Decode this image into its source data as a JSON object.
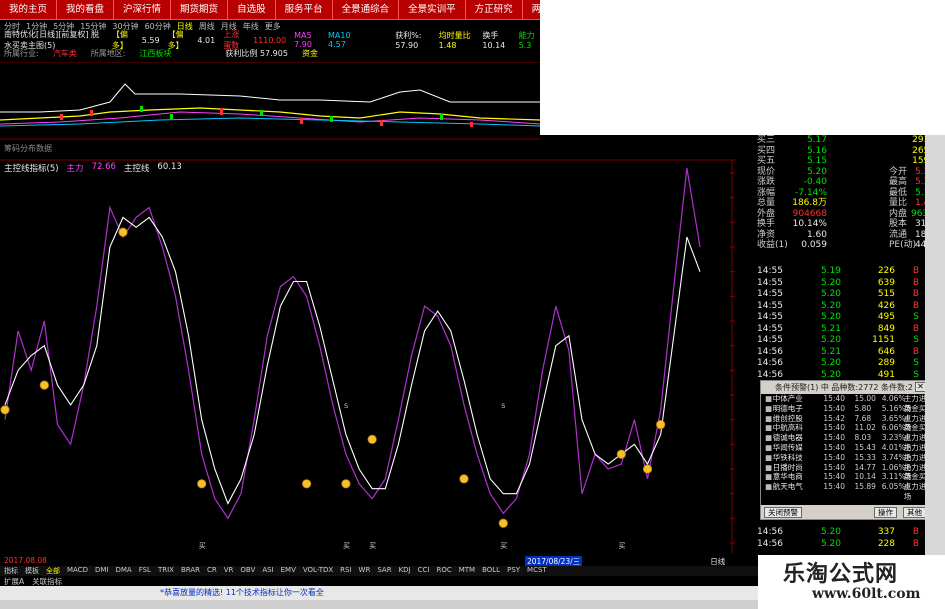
{
  "menu": [
    "我的主页",
    "我的看盘",
    "沪深行情",
    "期货期货",
    "自选股",
    "服务平台",
    "全景通综合",
    "全景实训平",
    "方正研究",
    "两融外港"
  ],
  "periods": [
    "分时",
    "1分钟",
    "5分钟",
    "15分钟",
    "30分钟",
    "60分钟",
    "日线",
    "周线",
    "月线",
    "年线",
    "更多"
  ],
  "info1": {
    "stock": "南特优化[日线][前复权] 脱水买卖主图(5)",
    "tag": "【偏多】",
    "ma": "5.59",
    "tag2": "【偏多】",
    "val": "4.01",
    "up_label": "上涨蛋数",
    "v1": "1110.00",
    "v2": "MA5 7.90",
    "v3": "MA10 4.57",
    "right1": "获利%: 57.90",
    "right2": "均时量比 1.48",
    "right3": "换手 10.14",
    "right4": "能力 5.3"
  },
  "info2": {
    "ind_label": "所属行业:",
    "ind": "汽车类",
    "region_label": "所属地区:",
    "region": "江西板块",
    "profit_label": "获利比例 57.905",
    "tag": "资金"
  },
  "sub_title": "筹码分布数据",
  "osc": {
    "name": "主控线指标(5)",
    "main_label": "主力",
    "main_val": "72.66",
    "line_label": "主控线",
    "line_val": "60.13"
  },
  "quote": [
    {
      "l": "买三",
      "v": "5.17",
      "vc": "#00e000",
      "r": "",
      "rv": "2914",
      "rc": "#ffff00"
    },
    {
      "l": "买四",
      "v": "5.16",
      "vc": "#00e000",
      "r": "",
      "rv": "2655",
      "rc": "#ffff00"
    },
    {
      "l": "买五",
      "v": "5.15",
      "vc": "#00e000",
      "r": "",
      "rv": "1598",
      "rc": "#ffff00"
    },
    {
      "l": "现价",
      "v": "5.20",
      "vc": "#00e000",
      "r": "今开",
      "rv": "5.32",
      "rc": "#ff3030"
    },
    {
      "l": "涨跌",
      "v": "-0.40",
      "vc": "#00e000",
      "r": "最高",
      "rv": "5.37",
      "rc": "#ff3030"
    },
    {
      "l": "涨幅",
      "v": "-7.14%",
      "vc": "#00e000",
      "r": "最低",
      "rv": "5.18",
      "rc": "#00e000"
    },
    {
      "l": "总量",
      "v": "186.8万",
      "vc": "#ffff00",
      "r": "量比",
      "rv": "1.48",
      "rc": "#ff3030"
    },
    {
      "l": "外盘",
      "v": "904668",
      "vc": "#ff3030",
      "r": "内盘",
      "rv": "963721",
      "rc": "#00e000"
    },
    {
      "l": "换手",
      "v": "10.14%",
      "vc": "#e8e8e8",
      "r": "股本",
      "rv": "31.3亿",
      "rc": "#e8e8e8"
    },
    {
      "l": "净资",
      "v": "1.60",
      "vc": "#e8e8e8",
      "r": "流通",
      "rv": "18.4亿",
      "rc": "#e8e8e8"
    },
    {
      "l": "收益(1)",
      "v": "0.059",
      "vc": "#e8e8e8",
      "r": "PE(动)",
      "rv": "44.1",
      "rc": "#e8e8e8"
    }
  ],
  "ticks": [
    {
      "t": "14:55",
      "p": "5.19",
      "v": "226",
      "d": "B",
      "dc": "#ff3030"
    },
    {
      "t": "14:55",
      "p": "5.20",
      "v": "639",
      "d": "B",
      "dc": "#ff3030"
    },
    {
      "t": "14:55",
      "p": "5.20",
      "v": "515",
      "d": "B",
      "dc": "#ff3030"
    },
    {
      "t": "14:55",
      "p": "5.20",
      "v": "426",
      "d": "B",
      "dc": "#ff3030"
    },
    {
      "t": "14:55",
      "p": "5.20",
      "v": "495",
      "d": "S",
      "dc": "#00e000"
    },
    {
      "t": "14:55",
      "p": "5.21",
      "v": "849",
      "d": "B",
      "dc": "#ff3030"
    },
    {
      "t": "14:55",
      "p": "5.20",
      "v": "1151",
      "d": "S",
      "dc": "#00e000"
    },
    {
      "t": "14:56",
      "p": "5.21",
      "v": "646",
      "d": "B",
      "dc": "#ff3030"
    },
    {
      "t": "14:56",
      "p": "5.20",
      "v": "289",
      "d": "S",
      "dc": "#00e000"
    },
    {
      "t": "14:56",
      "p": "5.20",
      "v": "491",
      "d": "S",
      "dc": "#00e000"
    }
  ],
  "ticks_bottom": [
    {
      "t": "14:56",
      "p": "5.20",
      "v": "337",
      "d": "B",
      "dc": "#ff3030"
    },
    {
      "t": "14:56",
      "p": "5.20",
      "v": "228",
      "d": "B",
      "dc": "#ff3030"
    }
  ],
  "popup": {
    "title": "条件预警(1) 中 品种数:2772 条件数:2",
    "rows": [
      {
        "n": "中体产业",
        "tm": "15:40",
        "px": "15.00",
        "pc": "4.06%",
        "tg": "主力进场"
      },
      {
        "n": "明德电子",
        "tm": "15:40",
        "px": "5.80",
        "pc": "5.16%",
        "tg": "黄金买点"
      },
      {
        "n": "维创控股",
        "tm": "15:42",
        "px": "7.68",
        "pc": "3.65%",
        "tg": "主力进场"
      },
      {
        "n": "中航高科",
        "tm": "15:40",
        "px": "11.02",
        "pc": "6.06%",
        "tg": "黄金买点"
      },
      {
        "n": "德诚电器",
        "tm": "15:40",
        "px": "8.03",
        "pc": "3.23%",
        "tg": "主力进场"
      },
      {
        "n": "华闻传媒",
        "tm": "15:40",
        "px": "15.43",
        "pc": "4.01%",
        "tg": "主力进场"
      },
      {
        "n": "华铁科技",
        "tm": "15:40",
        "px": "15.33",
        "pc": "3.74%",
        "tg": "主力进场"
      },
      {
        "n": "日播时尚",
        "tm": "15:40",
        "px": "14.77",
        "pc": "1.06%",
        "tg": "主力进场"
      },
      {
        "n": "意华电商",
        "tm": "15:40",
        "px": "10.14",
        "pc": "3.11%",
        "tg": "黄金买点"
      },
      {
        "n": "航天电气",
        "tm": "15:40",
        "px": "15.89",
        "pc": "6.05%",
        "tg": "主力进场"
      }
    ],
    "close_btn": "关闭预警",
    "op_btn": "操作",
    "other_btn": "其他"
  },
  "axis_labels": [
    "95.00",
    "90.00",
    "85.00",
    "80.00",
    "75.00",
    "70.00",
    "65.00",
    "60.00",
    "55.00",
    "50.00",
    "45.00",
    "40.00",
    "35.00",
    "30.00",
    "25.00",
    "20.00"
  ],
  "date_labels": [
    "2017.08.08",
    "2017/08/23/三"
  ],
  "markers_buy": "买",
  "markers_s": "S",
  "tabs1": [
    "指标",
    "模板",
    "全部",
    "MACD",
    "DMI",
    "DMA",
    "FSL",
    "TRIX",
    "BRAR",
    "CR",
    "VR",
    "OBV",
    "ASI",
    "EMV",
    "VOL-TDX",
    "RSI",
    "WR",
    "SAR",
    "KDJ",
    "CCI",
    "ROC",
    "MTM",
    "BOLL",
    "PSY",
    "MCST"
  ],
  "tabs2": [
    "扩展A",
    "关联指标"
  ],
  "status_text": "*恭喜放量的精选! 11个技术指标让你一次看全",
  "day_label": "日线",
  "watermark": {
    "title": "乐淘公式网",
    "url": "www.60lt.com"
  },
  "chart_data": {
    "type": "line",
    "title": "主控线指标(5)",
    "ylim": [
      20,
      95
    ],
    "series": [
      {
        "name": "主力",
        "color": "#b030d0",
        "values": [
          45,
          63,
          55,
          65,
          44,
          40,
          52,
          68,
          88,
          82,
          86,
          88,
          80,
          70,
          55,
          38,
          29,
          25,
          30,
          45,
          62,
          72,
          74,
          70,
          60,
          48,
          38,
          32,
          29,
          33,
          45,
          58,
          68,
          66,
          60,
          48,
          38,
          30,
          26,
          29,
          38,
          55,
          68,
          59,
          30,
          38,
          35,
          36,
          45,
          33,
          47,
          72,
          96,
          80
        ]
      },
      {
        "name": "主控线",
        "color": "#ffffff",
        "values": [
          48,
          55,
          58,
          60,
          52,
          48,
          52,
          60,
          80,
          86,
          84,
          86,
          82,
          75,
          62,
          45,
          35,
          28,
          33,
          42,
          56,
          68,
          73,
          73,
          64,
          53,
          42,
          35,
          31,
          31,
          40,
          52,
          63,
          67,
          63,
          53,
          42,
          33,
          30,
          30,
          36,
          48,
          60,
          62,
          45,
          38,
          36,
          38,
          40,
          36,
          42,
          62,
          82,
          75
        ]
      }
    ],
    "buy_points": [
      {
        "i": 0,
        "v": 47
      },
      {
        "i": 3,
        "v": 52
      },
      {
        "i": 9,
        "v": 83
      },
      {
        "i": 15,
        "v": 32
      },
      {
        "i": 23,
        "v": 32
      },
      {
        "i": 26,
        "v": 32
      },
      {
        "i": 28,
        "v": 41
      },
      {
        "i": 35,
        "v": 33
      },
      {
        "i": 38,
        "v": 24
      },
      {
        "i": 47,
        "v": 38
      },
      {
        "i": 49,
        "v": 35
      },
      {
        "i": 50,
        "v": 44
      }
    ]
  }
}
